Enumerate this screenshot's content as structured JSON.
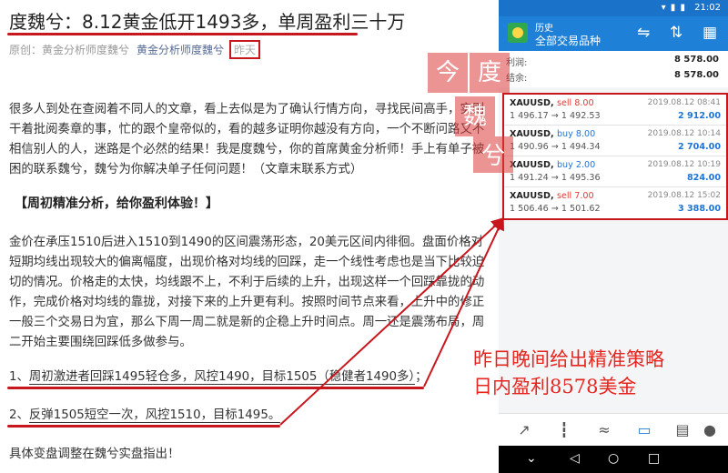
{
  "article": {
    "title": "度魏兮：8.12黄金低开1493多，单周盈利三十万",
    "meta_origin": "原创：黄金分析师度魏兮",
    "meta_author": "黄金分析师度魏兮",
    "meta_date": "昨天",
    "para1": "很多人到处在查阅着不同人的文章，看上去似是为了确认行情方向，寻找民间高手，实则干着批阅奏章的事，忙的跟个皇帝似的，看的越多证明你越没有方向，一个不断问路又不相信别人的人，迷路是个必然的结果！我是度魏兮，你的首席黄金分析师！手上有单子被困的联系魏兮，魏兮为你解决单子任何问题！（文章末联系方式）",
    "heading": "【周初精准分析，给你盈利体验！】",
    "para2": "金价在承压1510后进入1510到1490的区间震荡形态，20美元区间内徘徊。盘面价格对短期均线出现较大的偏离幅度，出现价格对均线的回踩，走一个线性考虑也是当下比较迫切的情况。价格走的太快，均线跟不上，不利于后续的上升，出现这样一个回踩靠拢的动作，完成价格对均线的靠拢，对接下来的上升更有利。按照时间节点来看，上升中的修正一般三个交易日为宜，那么下周一周二就是新的企稳上升时间点。周一还是震荡布局，周二开始主要围绕回踩低多做参与。",
    "item1_prefix": "1、",
    "item1_text": "周初激进者回踩1495轻仓多，风控1490，目标1505（稳健者1490多）",
    "item1_suffix": "；",
    "item2_prefix": "2、",
    "item2_text": "反弹1505短空一次，风控1510，目标1495。",
    "footer": "具体变盘调整在魏兮实盘指出！"
  },
  "watermark": {
    "c1": "今",
    "c2": "度",
    "c3": "魏",
    "c4": "兮"
  },
  "callout": {
    "line1": "昨日晚间给出精准策略",
    "line2": "日内盈利8578美金",
    "color": "#e5261f"
  },
  "phone": {
    "status": {
      "icons": "▾ ▮ ▮",
      "time": "21:02"
    },
    "appbar": {
      "title": "历史",
      "subtitle": "全部交易品种"
    },
    "summary": [
      {
        "label": "利润:",
        "value": "8 578.00"
      },
      {
        "label": "结余:",
        "value": "8 578.00"
      }
    ],
    "orders": [
      {
        "symbol": "XAUUSD,",
        "side": "sell 8.00",
        "type": "sell",
        "prices": "1 496.17 → 1 492.53",
        "datetime": "2019.08.12 08:41",
        "profit": "2 912.00"
      },
      {
        "symbol": "XAUUSD,",
        "side": "buy 8.00",
        "type": "buy",
        "prices": "1 490.96 → 1 494.34",
        "datetime": "2019.08.12 10:14",
        "profit": "2 704.00"
      },
      {
        "symbol": "XAUUSD,",
        "side": "buy 2.00",
        "type": "buy",
        "prices": "1 491.24 → 1 495.36",
        "datetime": "2019.08.12 10:19",
        "profit": "824.00"
      },
      {
        "symbol": "XAUUSD,",
        "side": "sell 7.00",
        "type": "sell",
        "prices": "1 506.46 → 1 501.62",
        "datetime": "2019.08.12 15:02",
        "profit": "3 388.00"
      }
    ],
    "colors": {
      "header": "#1e80d6",
      "sell": "#e53935",
      "buy": "#1e73d6",
      "highlight": "#c8161d"
    }
  }
}
